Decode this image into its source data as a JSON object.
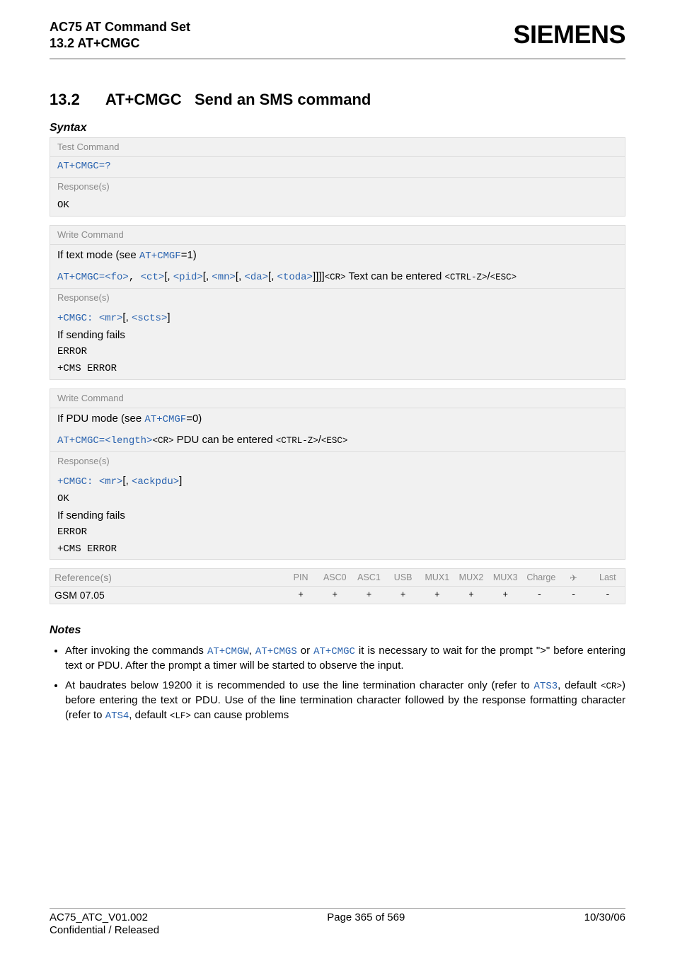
{
  "header": {
    "title_line1": "AC75 AT Command Set",
    "title_line2": "13.2 AT+CMGC",
    "brand": "SIEMENS"
  },
  "section": {
    "number": "13.2",
    "title_cmd": "AT+CMGC",
    "title_rest": "Send an SMS command"
  },
  "syntax_label": "Syntax",
  "box1": {
    "subhead": "Test Command",
    "test_cmd": "AT+CMGC=?",
    "responses_label": "Response(s)",
    "ok": "OK"
  },
  "box2": {
    "subhead": "Write Command",
    "if_prefix": "If text mode (see ",
    "if_link": "AT+CMGF",
    "if_suffix": "=1)",
    "cmd_prefix": "AT+CMGC=",
    "p_fo": "<fo>",
    "p_ct": "<ct>",
    "p_pid": "<pid>",
    "p_mn": "<mn>",
    "p_da": "<da>",
    "p_toda": "<toda>",
    "cr": "<CR>",
    "ctrlz": "<CTRL-Z>",
    "esc": "<ESC>",
    "text_can": " Text can be entered ",
    "responses_label": "Response(s)",
    "resp_prefix": "+CMGC: ",
    "p_mr": "<mr>",
    "p_scts": "<scts>",
    "fails": "If sending fails",
    "error": "ERROR",
    "cms": "+CMS ERROR"
  },
  "box3": {
    "subhead": "Write Command",
    "if_prefix": "If PDU mode (see ",
    "if_link": "AT+CMGF",
    "if_suffix": "=0)",
    "cmd_prefix": "AT+CMGC=",
    "p_length": "<length>",
    "cr": "<CR>",
    "pdu_can": " PDU can be entered ",
    "ctrlz": "<CTRL-Z>",
    "esc": "<ESC>",
    "responses_label": "Response(s)",
    "resp_prefix": "+CMGC: ",
    "p_mr": "<mr>",
    "p_ackpdu": "<ackpdu>",
    "ok": "OK",
    "fails": "If sending fails",
    "error": "ERROR",
    "cms": "+CMS ERROR"
  },
  "ref": {
    "reference_label": "Reference(s)",
    "reference_value": "GSM 07.05",
    "cols": [
      "PIN",
      "ASC0",
      "ASC1",
      "USB",
      "MUX1",
      "MUX2",
      "MUX3",
      "Charge",
      "✈",
      "Last"
    ],
    "vals": [
      "+",
      "+",
      "+",
      "+",
      "+",
      "+",
      "+",
      "-",
      "-",
      "-"
    ]
  },
  "notes": {
    "label": "Notes",
    "n1_pre": "After invoking the commands ",
    "n1_c1": "AT+CMGW",
    "n1_sep1": ", ",
    "n1_c2": "AT+CMGS",
    "n1_sep2": " or ",
    "n1_c3": "AT+CMGC",
    "n1_post": " it is necessary to wait for the prompt \">\" before entering text or PDU. After the prompt a timer will be started to observe the input.",
    "n2_pre": "At baudrates below 19200 it is recommended to use the line termination character only (refer to ",
    "n2_ats3": "ATS3",
    "n2_mid1": ", default ",
    "n2_cr": "<CR>",
    "n2_mid2": ") before entering the text or PDU. Use of the line termination character followed by the response formatting character (refer to ",
    "n2_ats4": "ATS4",
    "n2_mid3": ", default ",
    "n2_lf": "<LF>",
    "n2_post": " can cause problems"
  },
  "footer": {
    "left": "AC75_ATC_V01.002",
    "center": "Page 365 of 569",
    "right": "10/30/06",
    "sub": "Confidential / Released"
  }
}
